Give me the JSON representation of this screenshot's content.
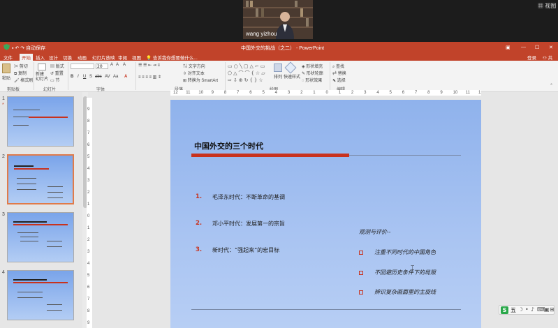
{
  "meeting": {
    "participant_name": "wang yizhou",
    "view_label": "视图"
  },
  "window": {
    "title": "中国外交的挑战（之二） - PowerPoint",
    "quick_access": "自动保存",
    "login_label": "登录",
    "share_label": "共享"
  },
  "tabs": [
    "文件",
    "开始",
    "插入",
    "设计",
    "切换",
    "动画",
    "幻灯片放映",
    "审阅",
    "视图"
  ],
  "tell_me": "告诉我你想要做什么...",
  "ribbon": {
    "clipboard": {
      "paste": "粘贴",
      "cut": "剪切",
      "copy": "复制",
      "format_painter": "格式刷",
      "group": "剪贴板"
    },
    "slides": {
      "new_slide": "新建\n幻灯片",
      "layout": "版式",
      "reset": "重置",
      "section": "节",
      "group": "幻灯片"
    },
    "font": {
      "size": "20",
      "group": "字体"
    },
    "paragraph": {
      "text_direction": "文字方向",
      "align_text": "对齐文本",
      "smartart": "转换为 SmartArt",
      "group": "段落"
    },
    "drawing": {
      "arrange": "排列",
      "quick_styles": "快速样式",
      "fill": "形状填充",
      "outline": "形状轮廓",
      "effects": "形状效果",
      "group": "绘图"
    },
    "editing": {
      "find": "查找",
      "replace": "替换",
      "select": "选择",
      "group": "编辑"
    }
  },
  "ruler": {
    "h_ticks": [
      "12",
      "11",
      "10",
      "9",
      "8",
      "7",
      "6",
      "5",
      "4",
      "3",
      "2",
      "1",
      "0",
      "1",
      "2",
      "3",
      "4",
      "5",
      "6",
      "7",
      "8",
      "9",
      "10",
      "11",
      "12"
    ],
    "v_ticks": [
      "9",
      "8",
      "7",
      "6",
      "5",
      "4",
      "3",
      "2",
      "1",
      "0",
      "1",
      "2",
      "3",
      "4",
      "5",
      "6",
      "7",
      "8",
      "9"
    ]
  },
  "thumbnails": [
    {
      "num": "1",
      "star": "*",
      "selected": false
    },
    {
      "num": "2",
      "selected": true
    },
    {
      "num": "3",
      "selected": false
    },
    {
      "num": "4",
      "selected": false
    }
  ],
  "slide": {
    "title": "中国外交的三个时代",
    "items": [
      {
        "num": "1.",
        "text": "毛泽东时代：不断革命的基调"
      },
      {
        "num": "2.",
        "text": "邓小平时代：发展第一的宗旨"
      },
      {
        "num": "3.",
        "text": "新时代：“强起来”的宏目标"
      }
    ],
    "eval_title": "观测与评价--",
    "eval_items": [
      "注重不同时代的中国角色",
      "不回避历史条件下的局限",
      "辨识复杂画面里的主旋线"
    ]
  },
  "ime": {
    "label": "五"
  },
  "colors": {
    "accent": "#c1432a",
    "slide_red": "#c8321e",
    "slide_bg": "#9bbcf0"
  }
}
